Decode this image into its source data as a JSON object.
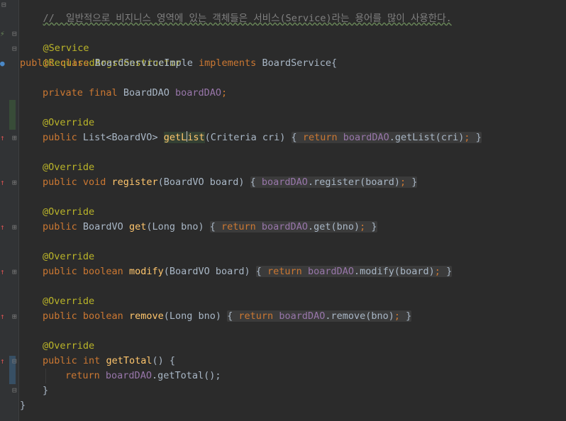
{
  "editor": {
    "comment_line": "//  일반적으로 비지니스 영역에 있는 객체들은 서비스(Service)라는 용어를 많이 사용한다.",
    "annotations": {
      "service": "@Service",
      "ctor": "@RequiredArgsConstructor"
    },
    "class_decl": {
      "kw_public": "public",
      "kw_class": "class",
      "name": "BoardServiceImple",
      "kw_implements": "implements",
      "iface": "BoardService{"
    },
    "field": {
      "kw_private": "private",
      "kw_final": "final",
      "type": "BoardDAO",
      "name": "boardDAO",
      "semi": ";"
    },
    "override": "@Override",
    "methods": [
      {
        "pre": "public ",
        "ret": "List<BoardVO> ",
        "name": "getList",
        "params": "(Criteria cri) ",
        "body_kw": "return ",
        "body_fld": "boardDAO",
        "body_call": ".getList(cri)",
        "semi": ";",
        "close": "}"
      },
      {
        "pre": "public ",
        "ret": "void ",
        "name": "register",
        "params": "(BoardVO board) ",
        "body_kw": "",
        "body_fld": "boardDAO",
        "body_call": ".register(board)",
        "semi": ";",
        "close": "}"
      },
      {
        "pre": "public ",
        "ret": "BoardVO ",
        "name": "get",
        "params": "(Long bno) ",
        "body_kw": "return ",
        "body_fld": "boardDAO",
        "body_call": ".get(bno)",
        "semi": ";",
        "close": "}"
      },
      {
        "pre": "public ",
        "ret": "boolean ",
        "name": "modify",
        "params": "(BoardVO board) ",
        "body_kw": "return ",
        "body_fld": "boardDAO",
        "body_call": ".modify(board)",
        "semi": ";",
        "close": "}"
      },
      {
        "pre": "public ",
        "ret": "boolean ",
        "name": "remove",
        "params": "(Long bno) ",
        "body_kw": "return ",
        "body_fld": "boardDAO",
        "body_call": ".remove(bno)",
        "semi": ";",
        "close": "}"
      }
    ],
    "get_total": {
      "kw_public": "public",
      "kw_int": "int",
      "name": "getTotal",
      "sig_rest": "() {",
      "body_kw": "return",
      "body_fld": "boardDAO",
      "body_call": ".getTotal();",
      "close": "}"
    },
    "class_close": "}",
    "open_brace": "{",
    "gutter_icons": {
      "bean": "bean-icon",
      "fold": "fold-icon",
      "override": "override-arrow-icon"
    }
  }
}
